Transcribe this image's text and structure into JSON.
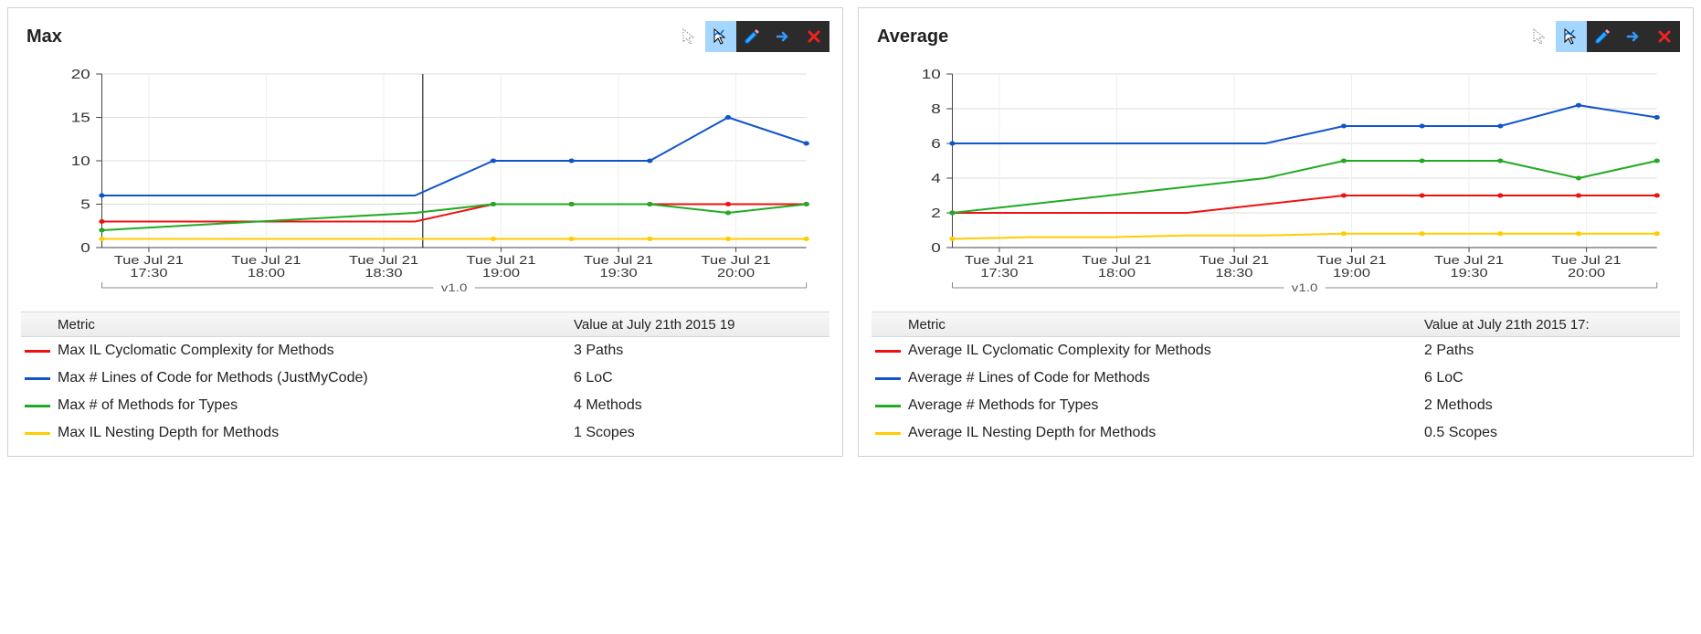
{
  "panels": [
    {
      "title": "Max",
      "table": {
        "metric_header": "Metric",
        "value_header": "Value at July 21th 2015  19",
        "rows": [
          {
            "color": "#e11",
            "metric": "Max IL Cyclomatic Complexity for Methods",
            "value": "3 Paths"
          },
          {
            "color": "#15c",
            "metric": "Max # Lines of Code for Methods (JustMyCode)",
            "value": "6 LoC"
          },
          {
            "color": "#2a2",
            "metric": "Max # of Methods for Types",
            "value": "4 Methods"
          },
          {
            "color": "#fc0",
            "metric": "Max IL Nesting Depth for Methods",
            "value": "1 Scopes"
          }
        ]
      }
    },
    {
      "title": "Average",
      "table": {
        "metric_header": "Metric",
        "value_header": "Value at July 21th 2015  17:",
        "rows": [
          {
            "color": "#e11",
            "metric": "Average IL Cyclomatic Complexity for Methods",
            "value": "2 Paths"
          },
          {
            "color": "#15c",
            "metric": "Average # Lines of Code for Methods",
            "value": "6 LoC"
          },
          {
            "color": "#2a2",
            "metric": "Average # Methods for Types",
            "value": "2 Methods"
          },
          {
            "color": "#fc0",
            "metric": "Average IL Nesting Depth for Methods",
            "value": "0.5 Scopes"
          }
        ]
      }
    }
  ],
  "chart_data": [
    {
      "type": "line",
      "title": "Max",
      "xlabel": "",
      "ylabel": "",
      "ylim": [
        0,
        20
      ],
      "yticks": [
        0,
        5,
        10,
        15,
        20
      ],
      "x_tick_labels": [
        "Tue Jul 21\n17:30",
        "Tue Jul 21\n18:00",
        "Tue Jul 21\n18:30",
        "Tue Jul 21\n19:00",
        "Tue Jul 21\n19:30",
        "Tue Jul 21\n20:00"
      ],
      "x_points": [
        0,
        1,
        2,
        3,
        4,
        5,
        6,
        7,
        8,
        9
      ],
      "bracket_label": "v1.0",
      "vline_at": 4.1,
      "series": [
        {
          "name": "Max IL Cyclomatic Complexity for Methods",
          "color": "#e11",
          "values": [
            3,
            3,
            3,
            3,
            3,
            5,
            5,
            5,
            5,
            5
          ]
        },
        {
          "name": "Max # Lines of Code for Methods (JustMyCode)",
          "color": "#15c",
          "values": [
            6,
            6,
            6,
            6,
            6,
            10,
            10,
            10,
            15,
            12
          ]
        },
        {
          "name": "Max # of Methods for Types",
          "color": "#2a2",
          "values": [
            2,
            2.5,
            3,
            3.5,
            4,
            5,
            5,
            5,
            4,
            5
          ]
        },
        {
          "name": "Max IL Nesting Depth for Methods",
          "color": "#fc0",
          "values": [
            1,
            1,
            1,
            1,
            1,
            1,
            1,
            1,
            1,
            1
          ]
        }
      ]
    },
    {
      "type": "line",
      "title": "Average",
      "xlabel": "",
      "ylabel": "",
      "ylim": [
        0,
        10
      ],
      "yticks": [
        0,
        2,
        4,
        6,
        8,
        10
      ],
      "x_tick_labels": [
        "Tue Jul 21\n17:30",
        "Tue Jul 21\n18:00",
        "Tue Jul 21\n18:30",
        "Tue Jul 21\n19:00",
        "Tue Jul 21\n19:30",
        "Tue Jul 21\n20:00"
      ],
      "x_points": [
        0,
        1,
        2,
        3,
        4,
        5,
        6,
        7,
        8,
        9
      ],
      "bracket_label": "v1.0",
      "vline_at": null,
      "series": [
        {
          "name": "Average IL Cyclomatic Complexity for Methods",
          "color": "#e11",
          "values": [
            2,
            2,
            2,
            2,
            2.5,
            3,
            3,
            3,
            3,
            3
          ]
        },
        {
          "name": "Average # Lines of Code for Methods",
          "color": "#15c",
          "values": [
            6,
            6,
            6,
            6,
            6,
            7,
            7,
            7,
            8.2,
            7.5
          ]
        },
        {
          "name": "Average # Methods for Types",
          "color": "#2a2",
          "values": [
            2,
            2.5,
            3,
            3.5,
            4,
            5,
            5,
            5,
            4,
            5
          ]
        },
        {
          "name": "Average IL Nesting Depth for Methods",
          "color": "#fc0",
          "values": [
            0.5,
            0.6,
            0.6,
            0.7,
            0.7,
            0.8,
            0.8,
            0.8,
            0.8,
            0.8
          ]
        }
      ]
    }
  ]
}
